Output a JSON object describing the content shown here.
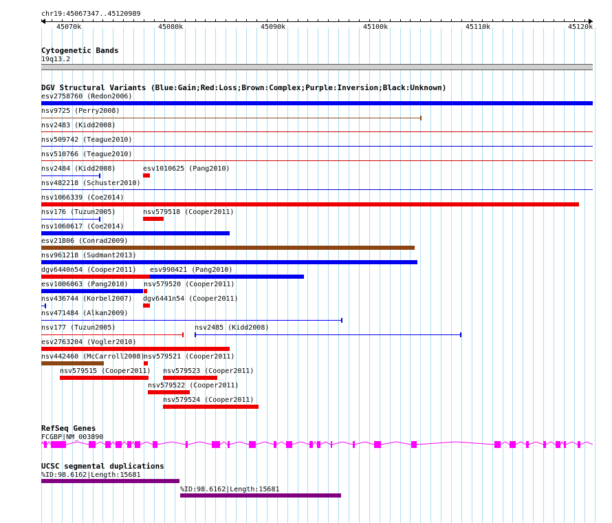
{
  "ruler": {
    "location": "chr19:45067347..45120989",
    "ticks": [
      "45070k",
      "45080k",
      "45090k",
      "45100k",
      "45110k",
      "45120k"
    ]
  },
  "tracks": {
    "cytoband": {
      "title": "Cytogenetic Bands",
      "band": "19q13.2"
    },
    "dgv": {
      "title": "DGV Structural Variants (Blue:Gain;Red:Loss;Brown:Complex;Purple:Inversion;Black:Unknown)",
      "colors": {
        "gain": "#0000ee",
        "loss": "#ee0000",
        "complex": "#8b4513",
        "inversion": "#800080",
        "unknown": "#000000"
      },
      "features": [
        "esv2758760 (Redon2006)",
        "nsv9725 (Perry2008)",
        "nsv2483 (Kidd2008)",
        "nsv509742 (Teague2010)",
        "nsv510766 (Teague2010)",
        "nsv2484 (Kidd2008)",
        "esv1010625 (Pang2010)",
        "nsv482218 (Schuster2010)",
        "nsv1066339 (Coe2014)",
        "nsv176 (Tuzun2005)",
        "nsv579518 (Cooper2011)",
        "nsv1060617 (Coe2014)",
        "esv21806 (Conrad2009)",
        "nsv961218 (Sudmant2013)",
        "dgv6440n54 (Cooper2011)",
        "esv990421 (Pang2010)",
        "esv1006063 (Pang2010)",
        "nsv579520 (Cooper2011)",
        "nsv436744 (Korbel2007)",
        "dgv6441n54 (Cooper2011)",
        "nsv471484 (Alkan2009)",
        "nsv177 (Tuzun2005)",
        "nsv2485 (Kidd2008)",
        "esv2763204 (Vogler2010)",
        "nsv442460 (McCarroll2008)",
        "nsv579521 (Cooper2011)",
        "nsv579515 (Cooper2011)",
        "nsv579523 (Cooper2011)",
        "nsv579522 (Cooper2011)",
        "nsv579524 (Cooper2011)"
      ]
    },
    "refseq": {
      "title": "RefSeq Genes",
      "gene": "FCGBP|NM_003890",
      "color": "#ff00ff"
    },
    "segdup": {
      "title": "UCSC segmental duplications",
      "color": "#800080",
      "features": [
        "%ID:98.6162|Length:15681",
        "%ID:98.6162|Length:15681"
      ]
    }
  }
}
